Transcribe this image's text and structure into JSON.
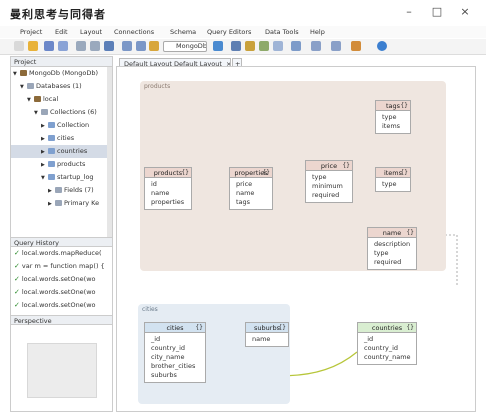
{
  "window": {
    "title": "曼利思考与同得者",
    "minimize": "–",
    "maximize": "□",
    "close": "×"
  },
  "menu": [
    "Project",
    "Edit",
    "Layout",
    "Connections",
    "Schema",
    "Query Editors",
    "Data Tools",
    "Help"
  ],
  "toolbar": {
    "connection": "MongoDb"
  },
  "project_panel": {
    "title": "Project",
    "tree": [
      {
        "label": "MongoDb (MongoDb)",
        "depth": 0,
        "toggle": "▼",
        "icon": "db"
      },
      {
        "label": "Databases (1)",
        "depth": 1,
        "toggle": "▼",
        "icon": "folder"
      },
      {
        "label": "local",
        "depth": 2,
        "toggle": "▼",
        "icon": "db"
      },
      {
        "label": "Collections (6)",
        "depth": 3,
        "toggle": "▼",
        "icon": "folder"
      },
      {
        "label": "Collection",
        "depth": 4,
        "toggle": "▶",
        "icon": "table"
      },
      {
        "label": "cities",
        "depth": 4,
        "toggle": "▶",
        "icon": "table"
      },
      {
        "label": "countries",
        "depth": 4,
        "toggle": "▶",
        "icon": "table",
        "selected": true
      },
      {
        "label": "products",
        "depth": 4,
        "toggle": "▶",
        "icon": "table"
      },
      {
        "label": "startup_log",
        "depth": 4,
        "toggle": "▼",
        "icon": "table"
      },
      {
        "label": "Fields (7)",
        "depth": 5,
        "toggle": "▶",
        "icon": "folder"
      },
      {
        "label": "Primary Ke",
        "depth": 5,
        "toggle": "▶",
        "icon": "folder"
      }
    ]
  },
  "query_history": {
    "title": "Query History",
    "items": [
      "local.words.mapReduce(",
      "var m = function map() {",
      "local.words.setOne(wo",
      "local.words.setOne(wo",
      "local.words.setOne(wo"
    ]
  },
  "perspective": {
    "title": "Perspective"
  },
  "tabs": {
    "layout": "Default Layout Default Layout",
    "add": "+"
  },
  "diagram": {
    "groups": {
      "products": "products",
      "cities": "cities"
    },
    "entities": {
      "products": {
        "title": "products",
        "fields": [
          "id",
          "name",
          "properties"
        ]
      },
      "properties": {
        "title": "properties",
        "fields": [
          "price",
          "name",
          "tags"
        ]
      },
      "price": {
        "title": "price",
        "fields": [
          "type",
          "minimum",
          "required"
        ]
      },
      "tags": {
        "title": "tags",
        "fields": [
          "type",
          "items"
        ]
      },
      "items": {
        "title": "items",
        "fields": [
          "type"
        ]
      },
      "name": {
        "title": "name",
        "fields": [
          "description",
          "type",
          "required"
        ]
      },
      "cities": {
        "title": "cities",
        "fields": [
          "_id",
          "country_id",
          "city_name",
          "brother_cities",
          "suburbs"
        ]
      },
      "suburbs": {
        "title": "suburbs",
        "fields": [
          "name"
        ]
      },
      "countries": {
        "title": "countries",
        "fields": [
          "_id",
          "country_id",
          "country_name"
        ]
      }
    },
    "colors": {
      "products_group": "#efe6e0",
      "cities_group": "#e5ecf3",
      "products_head": "#ecd6cf",
      "cities_head": "#d2e2f0",
      "countries_head": "#d9eed1",
      "relation": "#b7c63a"
    }
  }
}
